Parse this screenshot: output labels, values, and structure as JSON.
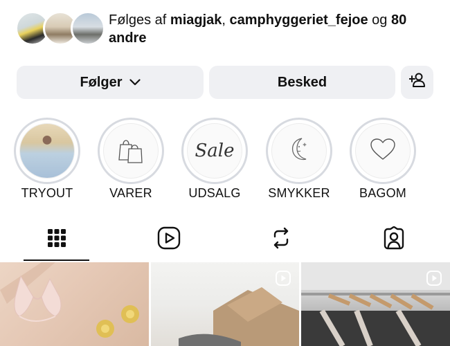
{
  "followed_by": {
    "prefix": "Følges af",
    "user1": "miagjak",
    "separator": ",",
    "user2": "camphyggeriet_fejoe",
    "conjunction": "og",
    "others": "80 andre"
  },
  "actions": {
    "follow_label": "Følger",
    "message_label": "Besked"
  },
  "highlights": [
    {
      "label": "TRYOUT"
    },
    {
      "label": "VARER"
    },
    {
      "label": "UDSALG",
      "cover_text": "Sale"
    },
    {
      "label": "SMYKKER"
    },
    {
      "label": "BAGOM"
    }
  ],
  "tabs": [
    {
      "icon": "grid-icon",
      "active": true
    },
    {
      "icon": "reels-icon"
    },
    {
      "icon": "reposts-icon"
    },
    {
      "icon": "tagged-icon"
    }
  ],
  "posts": [
    {
      "type": "image"
    },
    {
      "type": "reel"
    },
    {
      "type": "reel"
    }
  ],
  "colors": {
    "button_bg": "#eff0f3",
    "highlight_ring": "#d7dae0",
    "text": "#111111"
  }
}
